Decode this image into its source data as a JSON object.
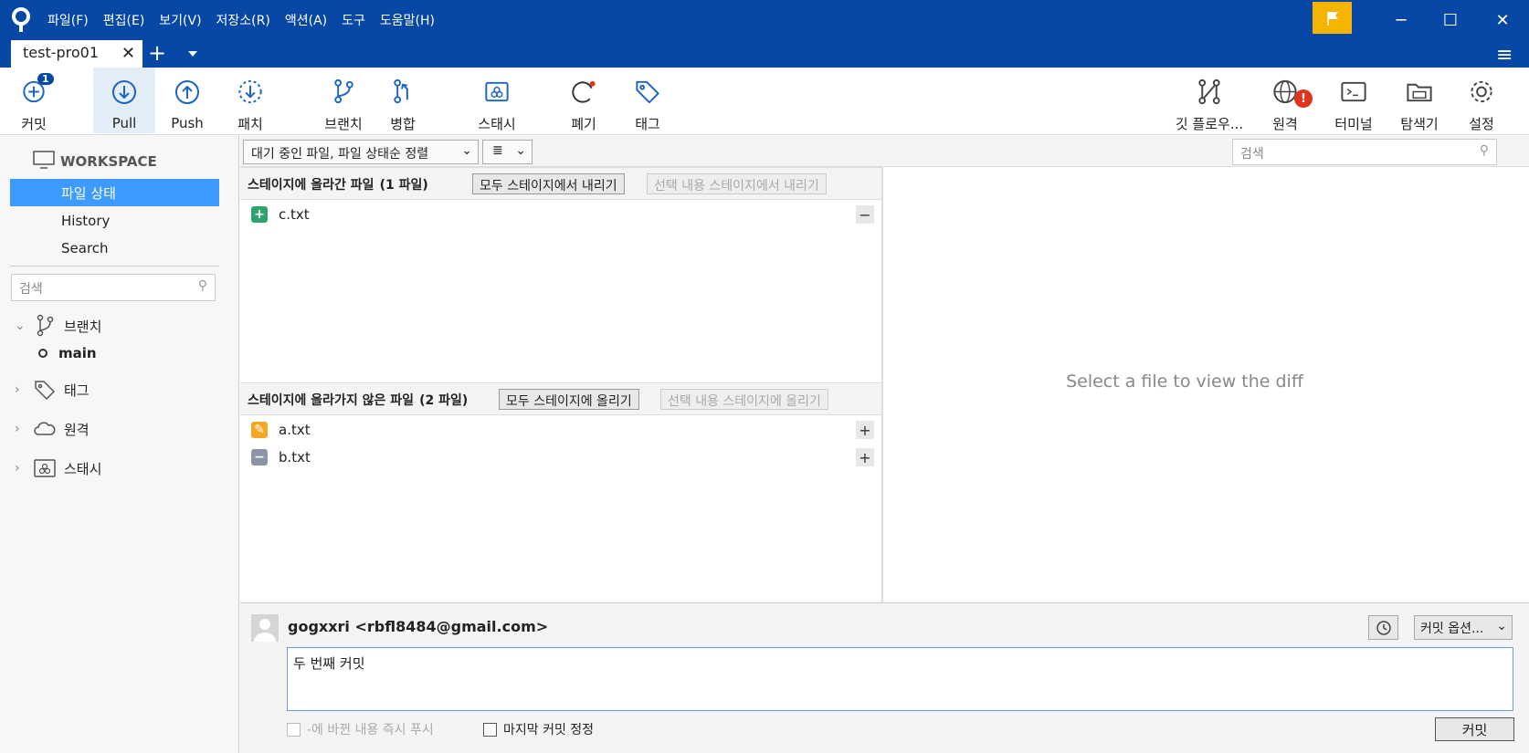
{
  "menu": [
    "파일(F)",
    "편집(E)",
    "보기(V)",
    "저장소(R)",
    "액션(A)",
    "도구",
    "도움말(H)"
  ],
  "window_controls": {
    "minimize": "─",
    "maximize": "☐",
    "close": "✕"
  },
  "tab": {
    "title": "test-pro01",
    "close": "✕",
    "add": "+"
  },
  "toolbar": {
    "commit": "커밋",
    "commit_badge": "1",
    "pull": "Pull",
    "push": "Push",
    "fetch": "패치",
    "branch": "브랜치",
    "merge": "병합",
    "stash": "스태시",
    "discard": "폐기",
    "tag": "태그",
    "gitflow": "깃 플로우...",
    "remote": "원격",
    "remote_badge": "!",
    "terminal": "터미널",
    "explorer": "탐색기",
    "settings": "설정"
  },
  "sidebar": {
    "workspace": "WORKSPACE",
    "items": [
      "파일 상태",
      "History",
      "Search"
    ],
    "search_placeholder": "검색",
    "branches": "브랜치",
    "current_branch": "main",
    "tags": "태그",
    "remotes": "원격",
    "stashes": "스태시"
  },
  "filter": {
    "sort": "대기 중인 파일, 파일 상태순 정렬",
    "view": "≣",
    "search_placeholder": "검색"
  },
  "staged": {
    "title": "스테이지에 올라간 파일",
    "count": "(1 파일)",
    "unstage_all": "모두 스테이지에서 내리기",
    "unstage_selected": "선택 내용 스테이지에서 내리기",
    "files": [
      {
        "name": "c.txt",
        "status": "added"
      }
    ]
  },
  "unstaged": {
    "title": "스테이지에 올라가지 않은 파일",
    "count": "(2 파일)",
    "stage_all": "모두 스테이지에 올리기",
    "stage_selected": "선택 내용 스테이지에 올리기",
    "files": [
      {
        "name": "a.txt",
        "status": "modified"
      },
      {
        "name": "b.txt",
        "status": "removed"
      }
    ]
  },
  "diff": {
    "placeholder": "Select a file to view the diff"
  },
  "commit": {
    "author": "gogxxri <rbfl8484@gmail.com>",
    "options": "커밋 옵션...",
    "message": "두 번째 커밋",
    "push_immediately": "-에 바뀐 내용 즉시 푸시",
    "amend": "마지막 커밋 정정",
    "button": "커밋"
  },
  "colors": {
    "titlebar": "#0747a6",
    "accent": "#3d9aff",
    "added": "#2fa36b",
    "modified": "#f5a623",
    "removed": "#8a96a8",
    "flag": "#f4b400"
  }
}
